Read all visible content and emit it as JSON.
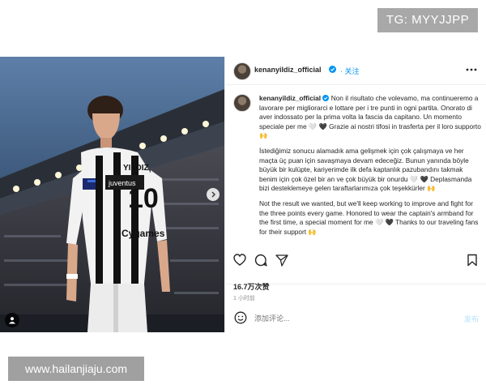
{
  "watermarks": {
    "top": "TG: MYYJJPP",
    "bottom": "www.hailanjiaju.com"
  },
  "photo": {
    "shirt_name": "YILDIZ",
    "shirt_number": "10",
    "armband_text": "juventus",
    "sponsor": "Cygames"
  },
  "header": {
    "username": "kenanyildiz_official",
    "follow_label": "· 关注",
    "more_icon": "more-horizontal-icon"
  },
  "caption": {
    "username": "kenanyildiz_official",
    "italian": "Non il risultato che volevamo, ma continueremo a lavorare per migliorarci e lottare per i tre punti in ogni partita. Onorato di aver indossato per la prima volta la fascia da capitano. Un momento speciale per me 🤍 🖤 Grazie ai nostri tifosi in trasferta per il loro supporto 🙌",
    "turkish": "İstediğimiz sonucu alamadık ama gelişmek için çok çalışmaya ve her maçta üç puan için savaşmaya devam edeceğiz. Bunun yanında böyle büyük bir kulüpte, kariyerimde ilk defa kaptanlık pazubandını takmak benim için çok özel bir an ve çok büyük bir onurdu 🤍 🖤 Deplasmanda bizi desteklemeye gelen taraftarlarımıza çok teşekkürler 🙌",
    "english": "Not the result we wanted, but we'll keep working to improve and fight for the three points every game. Honored to wear the captain's armband for the first time, a special moment for me 🤍 🖤 Thanks to our traveling fans for their support 🙌"
  },
  "stats": {
    "likes": "16.7万次赞",
    "time": "1 小时前"
  },
  "comment": {
    "placeholder": "添加评论...",
    "post_label": "发布"
  },
  "colors": {
    "link_blue": "#0095f6",
    "divider": "#efefef",
    "muted": "#8e8e8e"
  }
}
